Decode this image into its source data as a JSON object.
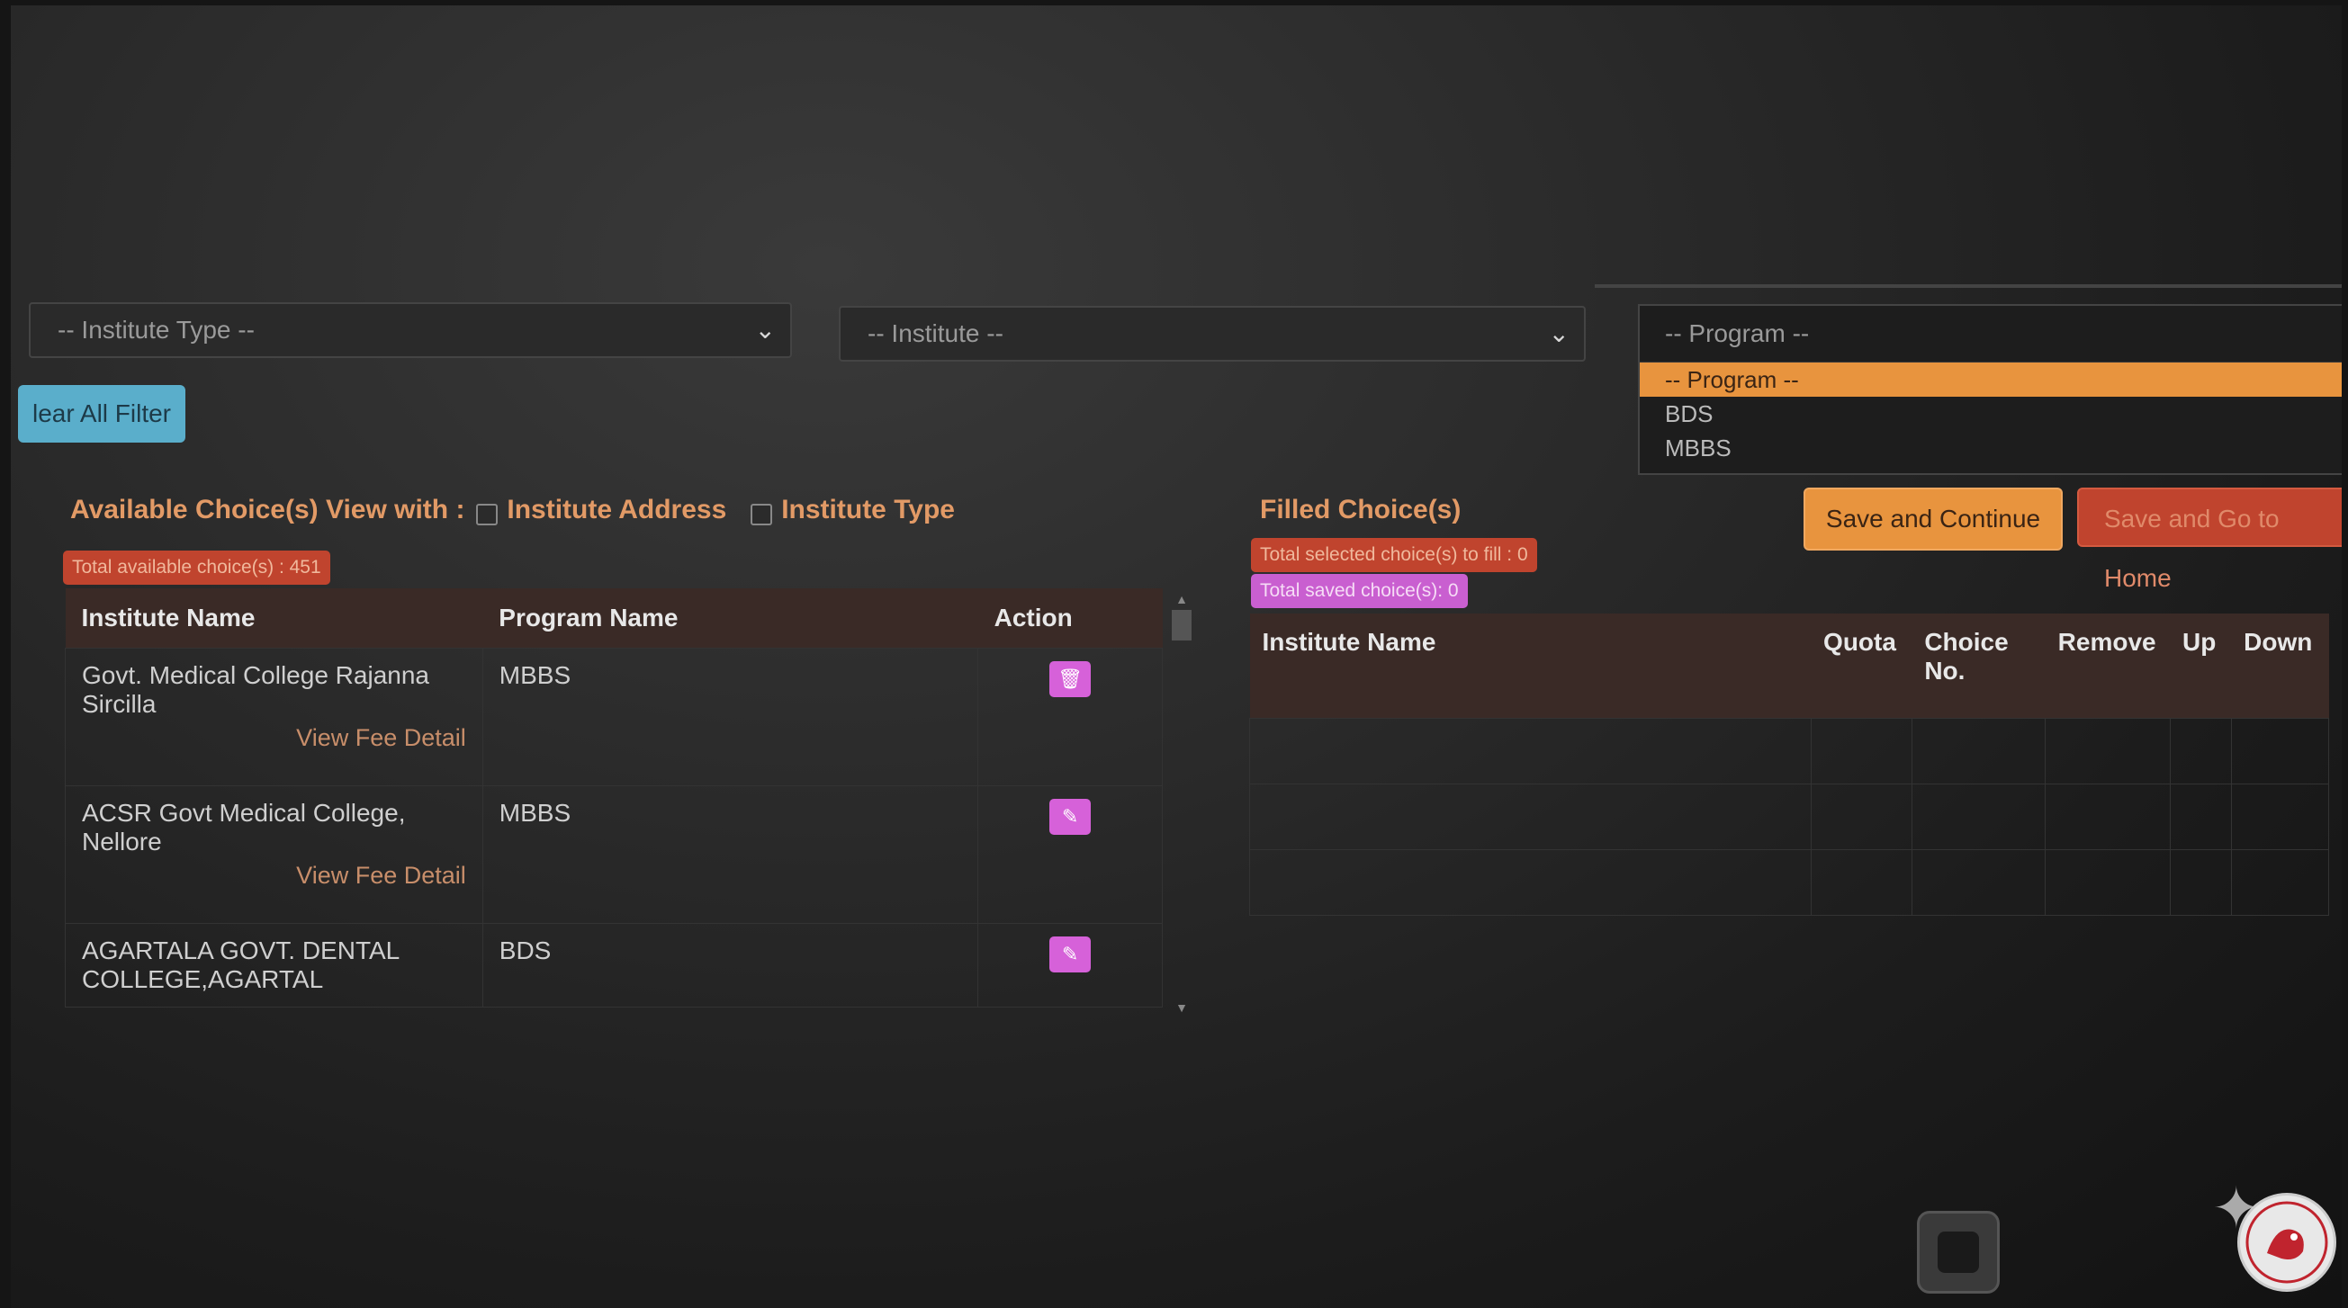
{
  "filters": {
    "institute_type_placeholder": "-- Institute Type --",
    "institute_placeholder": "-- Institute --",
    "program_placeholder": "-- Program --",
    "program_options": [
      "-- Program --",
      "BDS",
      "MBBS"
    ],
    "clear_button": "lear All Filter"
  },
  "available": {
    "heading": "Available Choice(s) View with :",
    "check_address": "Institute Address",
    "check_type": "Institute Type",
    "total_badge": "Total available choice(s) : 451",
    "columns": [
      "Institute Name",
      "Program Name",
      "Action"
    ],
    "rows": [
      {
        "institute": "Govt. Medical College Rajanna Sircilla",
        "program": "MBBS",
        "fee": "View Fee Detail",
        "action_icon": "trash-icon"
      },
      {
        "institute": "ACSR Govt Medical College, Nellore",
        "program": "MBBS",
        "fee": "View Fee Detail",
        "action_icon": "edit-icon"
      },
      {
        "institute": "AGARTALA GOVT. DENTAL COLLEGE,AGARTAL",
        "program": "BDS",
        "fee": "",
        "action_icon": "edit-icon"
      }
    ]
  },
  "filled": {
    "heading": "Filled Choice(s)",
    "selected_badge": "Total selected choice(s) to fill : 0",
    "saved_badge": "Total saved choice(s): 0",
    "columns": [
      "Institute Name",
      "Quota",
      "Choice No.",
      "Remove",
      "Up",
      "Down"
    ]
  },
  "buttons": {
    "save_continue": "Save and Continue",
    "save_home": "Save and Go to Home"
  },
  "colors": {
    "accent_orange": "#e8943e",
    "badge_red": "#c0442e",
    "badge_pink": "#c95fd0",
    "clear_blue": "#5aaecb"
  }
}
